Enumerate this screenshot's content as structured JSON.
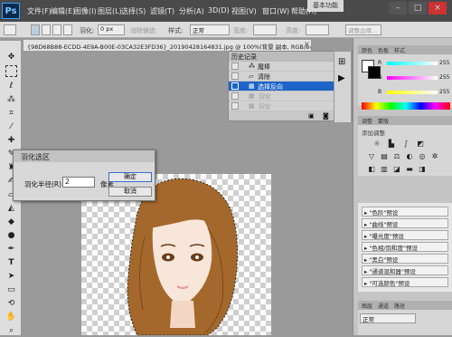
{
  "app": {
    "logo": "Ps",
    "menu": [
      "文件(F)",
      "编辑(E)",
      "图像(I)",
      "图层(L)",
      "选择(S)",
      "滤镜(T)",
      "分析(A)",
      "3D(D)",
      "视图(V)",
      "窗口(W)",
      "帮助(H)"
    ],
    "zoom": "100%",
    "workspace": "基本功能"
  },
  "options_bar": {
    "feather_label": "羽化:",
    "feather_value": "0 px",
    "antialias": "消除锯齿",
    "style_label": "样式:",
    "style_value": "正常",
    "width_label": "宽度:",
    "height_label": "高度:",
    "refine_edge": "调整边缘..."
  },
  "document": {
    "tab_title": "{98D68B88-ECDD-4E9A-B00E-03CA32E3FD36}_20190428164831.jpg @ 100%(背景 副本, RGB/8#..."
  },
  "history": {
    "title": "历史记录",
    "items": [
      {
        "label": "魔棒",
        "state": "normal"
      },
      {
        "label": "清除",
        "state": "normal"
      },
      {
        "label": "选择反向",
        "state": "selected"
      },
      {
        "label": "羽化",
        "state": "dim"
      },
      {
        "label": "羽化",
        "state": "dim"
      }
    ]
  },
  "color_panel": {
    "tabs": [
      "颜色",
      "色板",
      "样式"
    ],
    "r": "255",
    "g": "255",
    "b": "255"
  },
  "adjustments_panel": {
    "tabs": [
      "调整",
      "蒙版"
    ],
    "add_label": "添加调整"
  },
  "presets": [
    "\"色阶\"预设",
    "\"曲线\"预设",
    "\"曝光度\"预设",
    "\"色相/饱和度\"预设",
    "\"黑白\"预设",
    "\"通道混和器\"预设",
    "\"可选颜色\"预设"
  ],
  "layers_panel": {
    "tabs": [
      "图层",
      "通道",
      "路径"
    ],
    "blend_mode": "正常"
  },
  "dialog": {
    "title": "羽化选区",
    "radius_label": "羽化半径(R):",
    "radius_value": "2",
    "unit": "像素",
    "ok_label": "确定",
    "cancel_label": "取消"
  }
}
